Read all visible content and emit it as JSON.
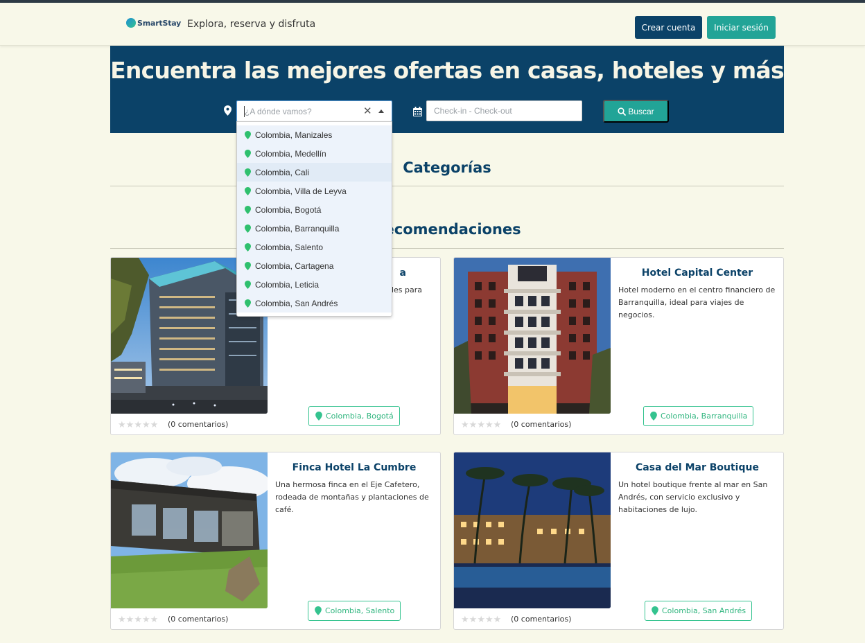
{
  "header": {
    "logo_text": "SmartStay",
    "slogan": "Explora, reserva y disfruta",
    "create_account": "Crear cuenta",
    "login": "Iniciar sesión"
  },
  "hero": {
    "title": "Encuentra las mejores ofertas en casas, hoteles y más",
    "city_placeholder": "¿A dónde vamos?",
    "date_placeholder": "Check-in - Check-out",
    "search_label": "Buscar"
  },
  "dropdown": {
    "options": [
      "Colombia, Manizales",
      "Colombia, Medellín",
      "Colombia, Cali",
      "Colombia, Villa de Leyva",
      "Colombia, Bogotá",
      "Colombia, Barranquilla",
      "Colombia, Salento",
      "Colombia, Cartagena",
      "Colombia, Leticia",
      "Colombia, San Andrés"
    ],
    "highlighted": "Colombia, Cali"
  },
  "sections": {
    "categories": "Categorías",
    "recommendations": "Recomendaciones"
  },
  "cards": [
    {
      "name": "a",
      "desc": "des para",
      "comments": "(0 comentarios)",
      "location": "Colombia, Bogotá",
      "rating": 0
    },
    {
      "name": "Hotel Capital Center",
      "desc": "Hotel moderno en el centro financiero de Barranquilla, ideal para viajes de negocios.",
      "comments": "(0 comentarios)",
      "location": "Colombia, Barranquilla",
      "rating": 0
    },
    {
      "name": "Finca Hotel La Cumbre",
      "desc": "Una hermosa finca en el Eje Cafetero, rodeada de montañas y plantaciones de café.",
      "comments": "(0 comentarios)",
      "location": "Colombia, Salento",
      "rating": 0
    },
    {
      "name": "Casa del Mar Boutique",
      "desc": "Un hotel boutique frente al mar en San Andrés, con servicio exclusivo y habitaciones de lujo.",
      "comments": "(0 comentarios)",
      "location": "Colombia, San Andrés",
      "rating": 0
    }
  ],
  "colors": {
    "navy": "#0b4268",
    "teal": "#22a497",
    "green": "#34c38f",
    "page_bg": "#f8f8e9"
  }
}
